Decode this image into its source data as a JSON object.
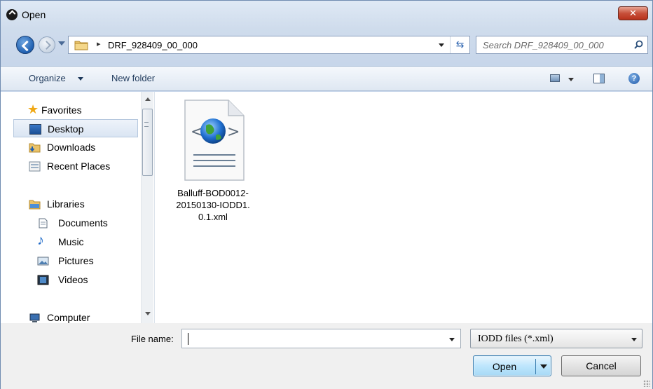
{
  "window": {
    "title": "Open"
  },
  "navigation": {
    "breadcrumb": [
      "DRF_928409_00_000"
    ],
    "search_placeholder": "Search DRF_928409_00_000"
  },
  "toolbar": {
    "organize_label": "Organize",
    "new_folder_label": "New folder"
  },
  "sidebar": {
    "items": [
      {
        "label": "Favorites",
        "icon": "star-icon"
      },
      {
        "label": "Desktop",
        "icon": "desktop-icon",
        "selected": true
      },
      {
        "label": "Downloads",
        "icon": "downloads-folder-icon"
      },
      {
        "label": "Recent Places",
        "icon": "recent-places-icon"
      },
      {
        "label": "Libraries",
        "icon": "libraries-icon"
      },
      {
        "label": "Documents",
        "icon": "documents-icon"
      },
      {
        "label": "Music",
        "icon": "music-icon"
      },
      {
        "label": "Pictures",
        "icon": "pictures-icon"
      },
      {
        "label": "Videos",
        "icon": "videos-icon"
      },
      {
        "label": "Computer",
        "icon": "computer-icon"
      }
    ]
  },
  "files": [
    {
      "name_lines": [
        "Balluff-BOD0012-",
        "20150130-IODD1.",
        "0.1.xml"
      ],
      "icon": "xml-globe-file-icon"
    }
  ],
  "footer": {
    "file_name_label": "File name:",
    "file_name_value": "",
    "file_type_filter": "IODD files (*.xml)",
    "open_label": "Open",
    "cancel_label": "Cancel"
  },
  "colors": {
    "chrome_blue": "#cfdcec",
    "selection": "#dae5f3",
    "close_red": "#c7503a",
    "default_button": "#bee6fd"
  }
}
